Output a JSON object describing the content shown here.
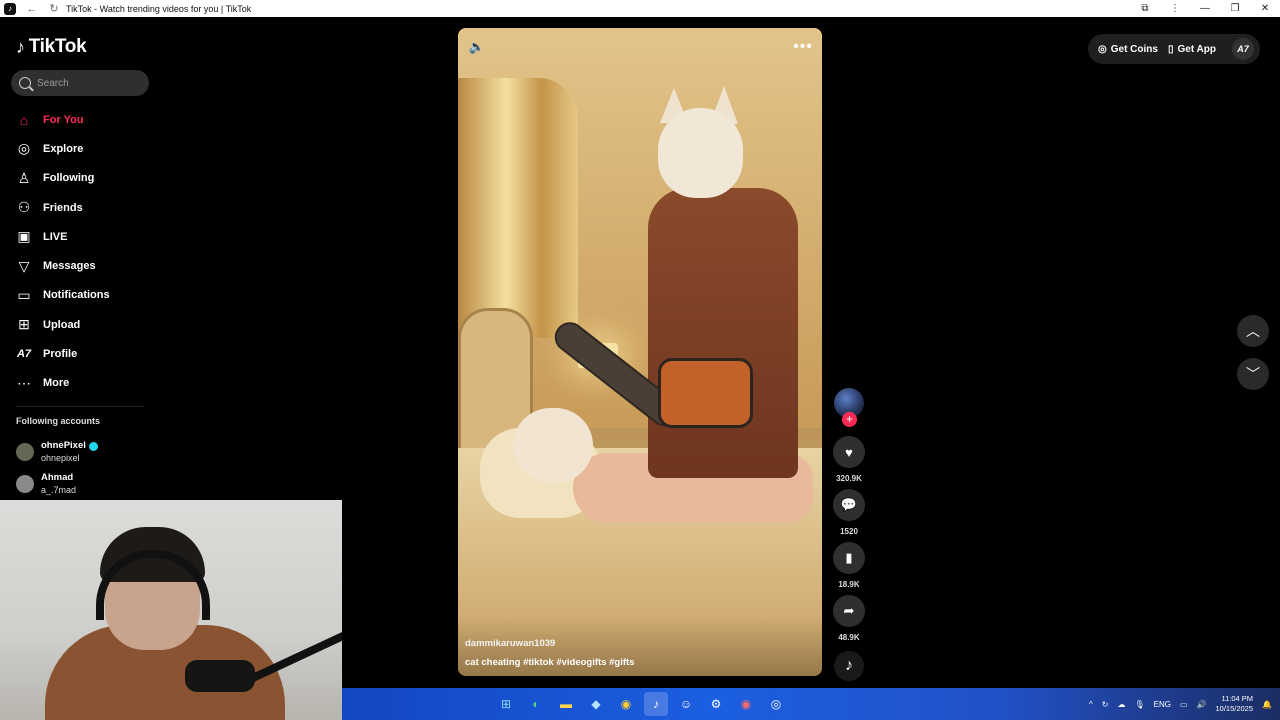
{
  "browser": {
    "title": "TikTok - Watch trending videos for you | TikTok",
    "back_icon": "arrow-left-icon",
    "reload_icon": "reload-icon"
  },
  "sidebar": {
    "logo_text": "TikTok",
    "search_placeholder": "Search",
    "items": [
      {
        "label": "For You",
        "icon": "home-icon",
        "active": true
      },
      {
        "label": "Explore",
        "icon": "compass-icon"
      },
      {
        "label": "Following",
        "icon": "following-icon"
      },
      {
        "label": "Friends",
        "icon": "friends-icon"
      },
      {
        "label": "LIVE",
        "icon": "live-icon"
      },
      {
        "label": "Messages",
        "icon": "messages-icon"
      },
      {
        "label": "Notifications",
        "icon": "notifications-icon"
      },
      {
        "label": "Upload",
        "icon": "upload-icon"
      },
      {
        "label": "Profile",
        "icon": "profile-icon"
      },
      {
        "label": "More",
        "icon": "more-icon"
      }
    ],
    "following_title": "Following accounts",
    "following": [
      {
        "name": "ohnePixel",
        "handle": "ohnepixel",
        "verified": true
      },
      {
        "name": "Ahmad",
        "handle": "a_.7mad",
        "verified": false
      }
    ]
  },
  "video": {
    "author": "dammikaruwan1039",
    "description": "cat cheating #tiktok #videogifts #gifts"
  },
  "actions": {
    "likes": "320.9K",
    "comments": "1520",
    "saves": "18.9K",
    "shares": "48.9K"
  },
  "topbar": {
    "get_coins": "Get Coins",
    "get_app": "Get App",
    "profile_initials": "A7"
  },
  "taskbar": {
    "lang": "ENG",
    "time": "11:04 PM",
    "date": "10/15/2025"
  },
  "colors": {
    "accent": "#fe2c55",
    "verified": "#20d5ec"
  }
}
